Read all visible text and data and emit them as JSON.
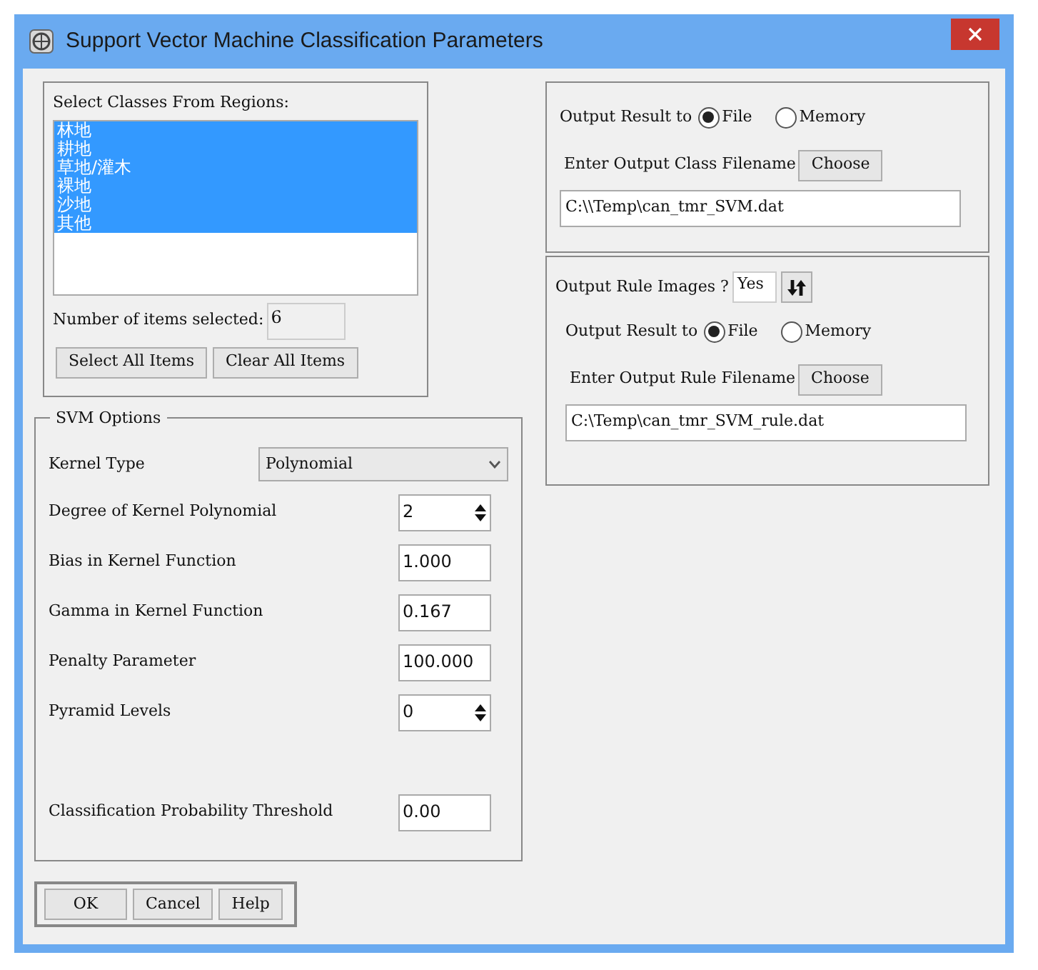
{
  "window": {
    "title": "Support Vector Machine Classification Parameters"
  },
  "classes": {
    "label": "Select Classes From Regions:",
    "items": [
      {
        "label": "林地",
        "selected": true
      },
      {
        "label": "耕地",
        "selected": true
      },
      {
        "label": "草地/灌木",
        "selected": true
      },
      {
        "label": "裸地",
        "selected": true
      },
      {
        "label": "沙地",
        "selected": true
      },
      {
        "label": "其他",
        "selected": true
      }
    ],
    "count_label": "Number of items selected:",
    "count": "6",
    "buttons": [
      "Select All Items",
      "Clear All Items"
    ]
  },
  "svm_options": {
    "title": "SVM Options",
    "kernel_type": {
      "label": "Kernel Type",
      "value": "Polynomial"
    },
    "params": [
      {
        "label": "Degree of Kernel Polynomial",
        "value": "2",
        "kind": "spinner"
      },
      {
        "label": "Bias in Kernel Function",
        "value": "1.000",
        "kind": "text"
      },
      {
        "label": "Gamma in Kernel Function",
        "value": "0.167",
        "kind": "text"
      },
      {
        "label": "Penalty Parameter",
        "value": "100.000",
        "kind": "text"
      },
      {
        "label": "Pyramid Levels",
        "value": "0",
        "kind": "spinner"
      }
    ],
    "threshold": {
      "label": "Classification Probability Threshold",
      "value": "0.00"
    }
  },
  "buttons": [
    "OK",
    "Cancel",
    "Help"
  ],
  "output_class": {
    "label": "Output Result to",
    "options": [
      {
        "label": "File",
        "selected": true
      },
      {
        "label": "Memory",
        "selected": false
      }
    ],
    "filename_label": "Enter Output Class Filename",
    "choose": "Choose",
    "filename": "C:\\\\Temp\\can_tmr_SVM.dat"
  },
  "rule_images": {
    "label": "Output Rule Images ?",
    "value": "Yes",
    "output_label": "Output Result to",
    "options": [
      {
        "label": "File",
        "selected": true
      },
      {
        "label": "Memory",
        "selected": false
      }
    ],
    "filename_label": "Enter Output Rule Filename",
    "choose": "Choose",
    "filename": "C:\\Temp\\can_tmr_SVM_rule.dat"
  }
}
